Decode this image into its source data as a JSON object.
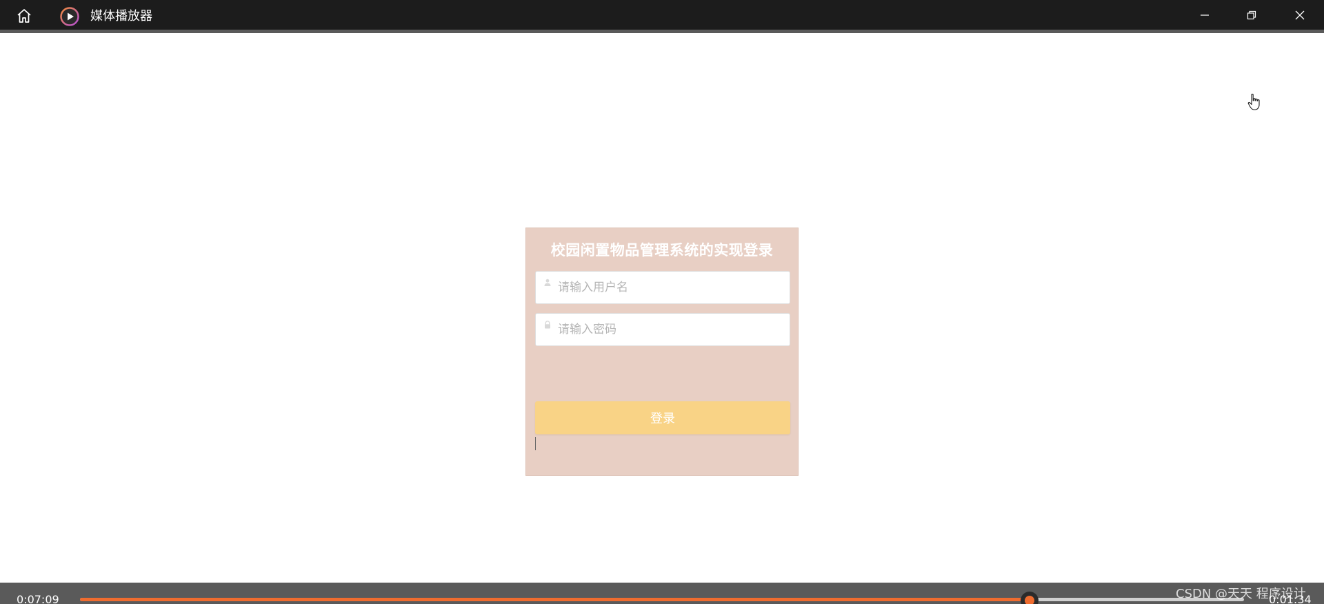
{
  "titlebar": {
    "app_title": "媒体播放器"
  },
  "login": {
    "title": "校园闲置物品管理系统的实现登录",
    "username_placeholder": "请输入用户名",
    "password_placeholder": "请输入密码",
    "submit_label": "登录"
  },
  "player": {
    "elapsed": "0:07:09",
    "remaining": "0:01:34",
    "progress": 0.816
  },
  "watermark": "CSDN @天天 程序设计",
  "colors": {
    "titlebar": "#1c1c1c",
    "card_background": "#e8cfc4",
    "login_button": "#f9d386",
    "progress_accent": "#ef6c2f",
    "player_bar": "#5a5a5a"
  },
  "icons": {
    "home": "home-icon",
    "app": "media-player-icon",
    "minimize": "minimize-icon",
    "maximize": "restore-icon",
    "close": "close-icon",
    "user": "user-icon",
    "lock": "lock-icon",
    "pointer": "hand-pointer-icon"
  }
}
